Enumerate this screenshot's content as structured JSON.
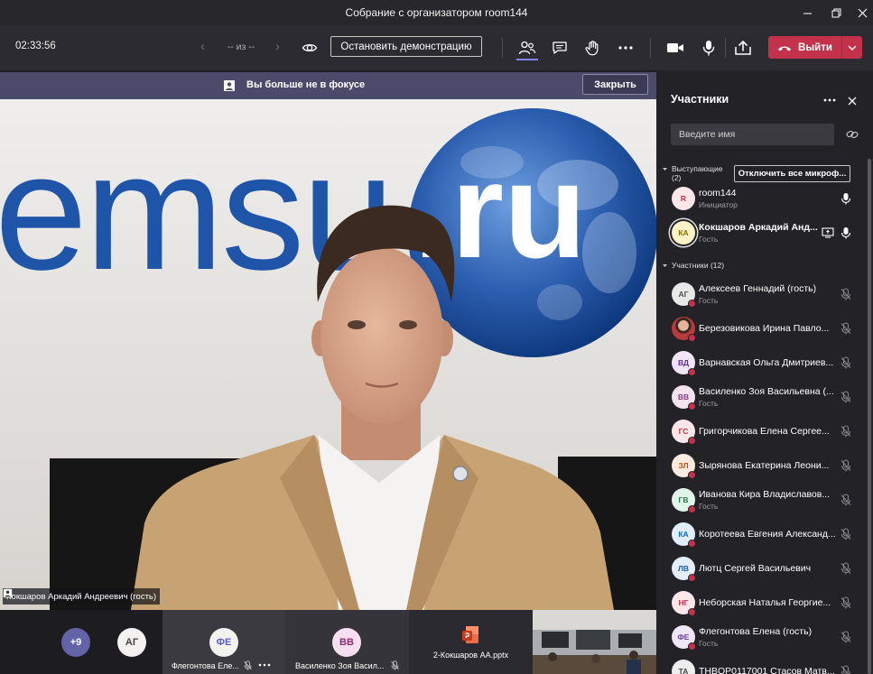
{
  "window": {
    "title": "Собрание с организатором room144"
  },
  "theme": {
    "accent": "#7f85f5",
    "leave": "#c4314b",
    "status_busy": "#c4314b",
    "banner": "#4b4a6a"
  },
  "toolbar": {
    "timer": "02:33:56",
    "page_counter": "-- из --",
    "stop_share_label": "Остановить демонстрацию",
    "leave_label": "Выйти"
  },
  "banner": {
    "text": "Вы больше не в фокусе",
    "close_label": "Закрыть"
  },
  "stage": {
    "backdrop_left": "emsu",
    "backdrop_right": ".ru",
    "speaker_label": "Кокшаров Аркадий Андреевич (гость)"
  },
  "gallery": {
    "overflow_count": "+9",
    "first_avatar": {
      "initials": "АГ",
      "fg": "#424242",
      "bg": "#f3f2f1"
    },
    "tiles": [
      {
        "initials": "ФЕ",
        "label": "Флегонтова Еле...",
        "fg": "#5b5fc7",
        "bg": "#f3f2f1"
      },
      {
        "initials": "ВВ",
        "label": "Василенко Зоя Васил...",
        "fg": "#8e2a6b",
        "bg": "#f6dff0"
      },
      {
        "label": "2-Кокшаров АА.pptx"
      }
    ]
  },
  "panel": {
    "title": "Участники",
    "search_placeholder": "Введите имя",
    "presenters": {
      "heading": "Выступающие",
      "count": "(2)",
      "mute_all_label": "Отключить все микроф...",
      "items": [
        {
          "initials": "R",
          "name": "room144",
          "role": "Инициатор",
          "fg": "#c4314b",
          "bg": "#fde7e9"
        },
        {
          "initials": "КА",
          "name": "Кокшаров Аркадий Анд...",
          "role": "Гость",
          "fg": "#8a6d00",
          "bg": "#fdf3c7"
        }
      ]
    },
    "attendees": {
      "heading": "Участники (12)",
      "items": [
        {
          "initials": "АГ",
          "name": "Алексеев Геннадий (гость)",
          "role": "Гость",
          "fg": "#4f4f4f",
          "bg": "#e8e8e8"
        },
        {
          "name": "Березовикова Ирина Павло..."
        },
        {
          "initials": "ВД",
          "name": "Варнавская Ольга Дмитриев...",
          "fg": "#5c2e91",
          "bg": "#f3e5f8"
        },
        {
          "initials": "ВВ",
          "name": "Василенко Зоя Васильевна (...",
          "role": "Гость",
          "fg": "#8b3d8b",
          "bg": "#f5e3f1"
        },
        {
          "initials": "ГС",
          "name": "Григорчикова Елена Сергее...",
          "fg": "#c4314b",
          "bg": "#fde7e9"
        },
        {
          "initials": "ЗЛ",
          "name": "Зырянова Екатерина Леони...",
          "fg": "#ca5010",
          "bg": "#fdebe0"
        },
        {
          "initials": "ГВ",
          "name": "Иванова Кира Владиславов...",
          "role": "Гость",
          "fg": "#237b4b",
          "bg": "#e1f4e9"
        },
        {
          "initials": "КА",
          "name": "Коротеева Евгения Александ...",
          "fg": "#0f6cbd",
          "bg": "#e0eef9"
        },
        {
          "initials": "ЛВ",
          "name": "Лютц Сергей Васильевич",
          "fg": "#1b5fa8",
          "bg": "#e3eefb"
        },
        {
          "initials": "НГ",
          "name": "Неборская Наталья Георгие...",
          "fg": "#c4314b",
          "bg": "#fde7e9"
        },
        {
          "initials": "ФЕ",
          "name": "Флегонтова Елена (гость)",
          "role": "Гость",
          "fg": "#6b3fa0",
          "bg": "#efe6f8"
        },
        {
          "initials": "ТА",
          "name": "THBOP0117001 Стасов Матв...",
          "fg": "#444444",
          "bg": "#eeeeee"
        }
      ]
    }
  }
}
